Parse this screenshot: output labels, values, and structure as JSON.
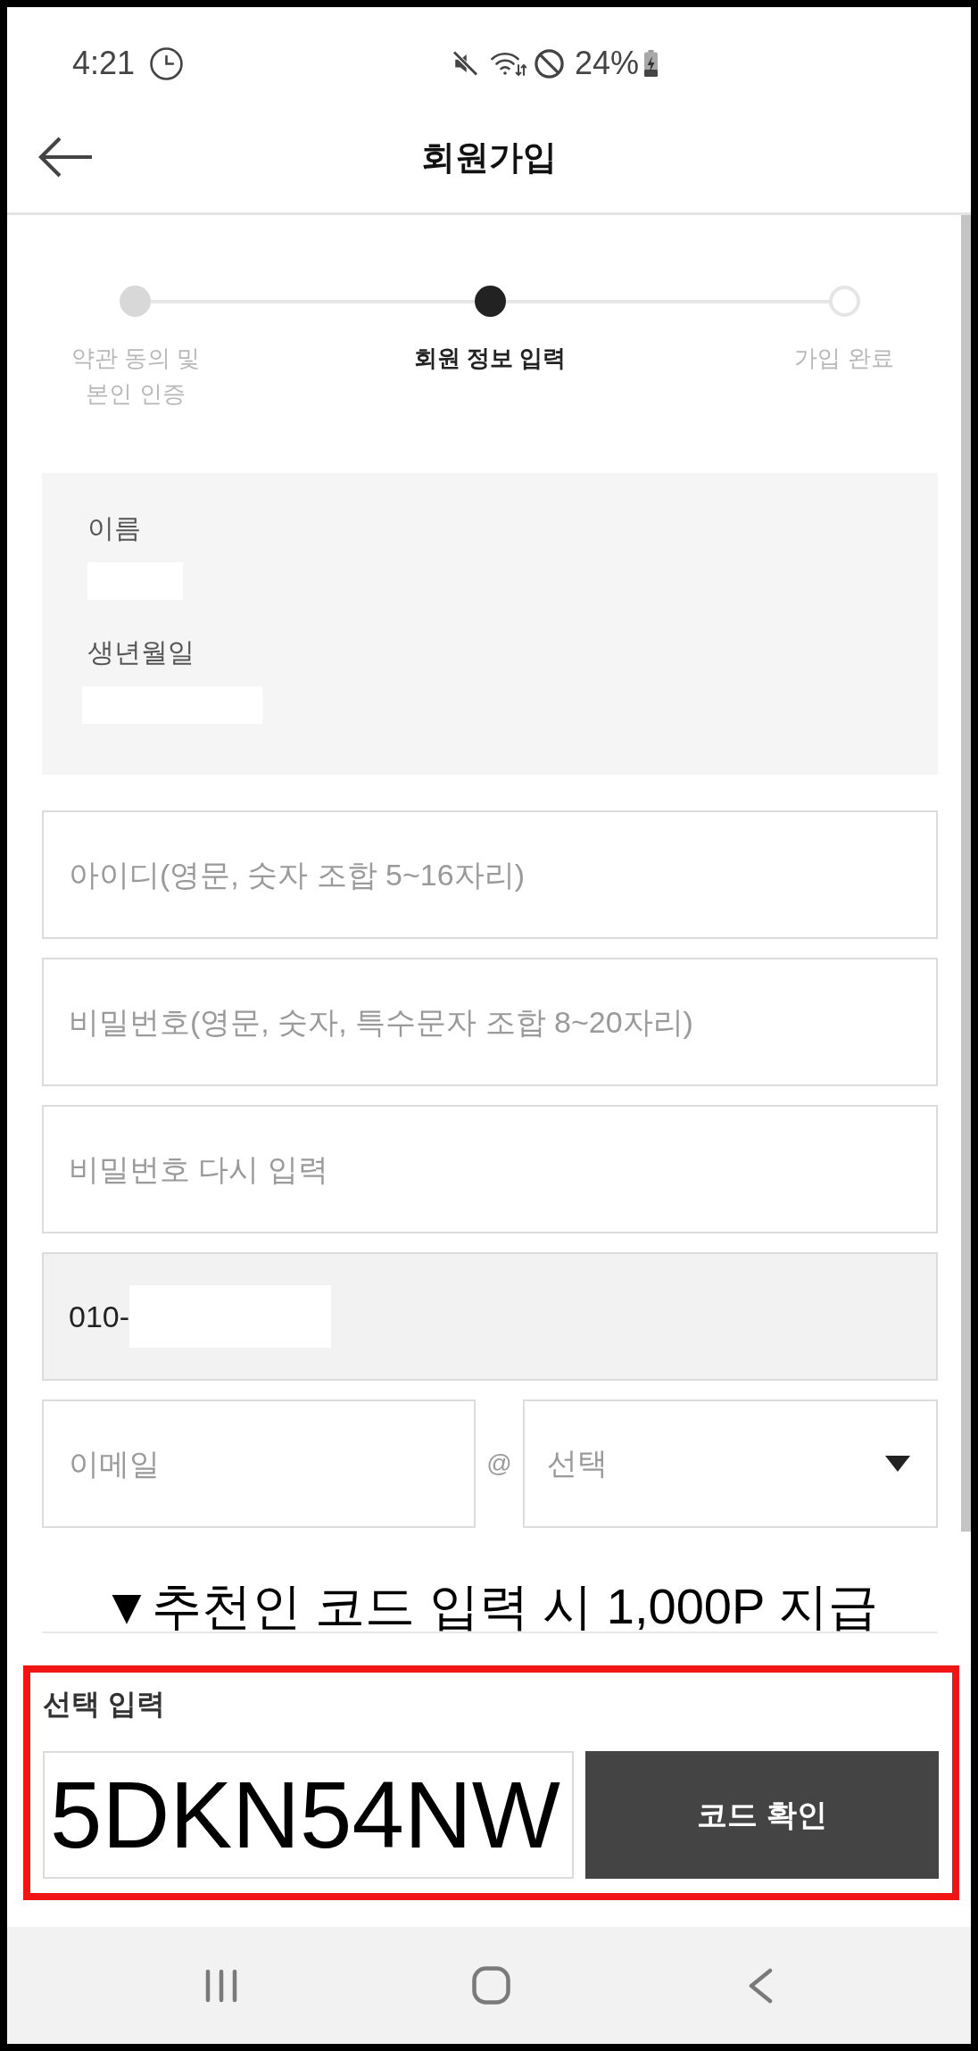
{
  "status_bar": {
    "time": "4:21",
    "battery": "24%"
  },
  "header": {
    "title": "회원가입"
  },
  "stepper": {
    "steps": [
      {
        "label": "약관 동의 및\n본인 인증",
        "completed": true,
        "selected": false
      },
      {
        "label": "회원 정보 입력",
        "completed": false,
        "selected": true
      },
      {
        "label": "가입 완료",
        "completed": false,
        "selected": false
      }
    ]
  },
  "member_info": {
    "fields": [
      {
        "label": "이름",
        "value_hidden": true
      },
      {
        "label": "생년월일",
        "value_hidden": true
      }
    ]
  },
  "form": {
    "fields": [
      {
        "kind": "text",
        "placeholder": "아이디(영문, 숫자 조합 5~16자리)",
        "disabled": false
      },
      {
        "kind": "text",
        "placeholder": "비밀번호(영문, 숫자, 특수문자 조합 8~20자리)",
        "disabled": false
      },
      {
        "kind": "text",
        "placeholder": "비밀번호 다시 입력",
        "disabled": false
      },
      {
        "kind": "phone",
        "value": "010-",
        "value_hidden": true,
        "disabled": true
      }
    ],
    "email": {
      "placeholder": "이메일",
      "separator": "@",
      "domain": {
        "placeholder": "선택"
      }
    }
  },
  "referral": {
    "banner": "▼추천인 코드 입력 시 1,000P 지급",
    "highlighted": true,
    "label": "선택 입력",
    "code": {
      "value": "5DKN54NW"
    },
    "button": "코드 확인"
  }
}
